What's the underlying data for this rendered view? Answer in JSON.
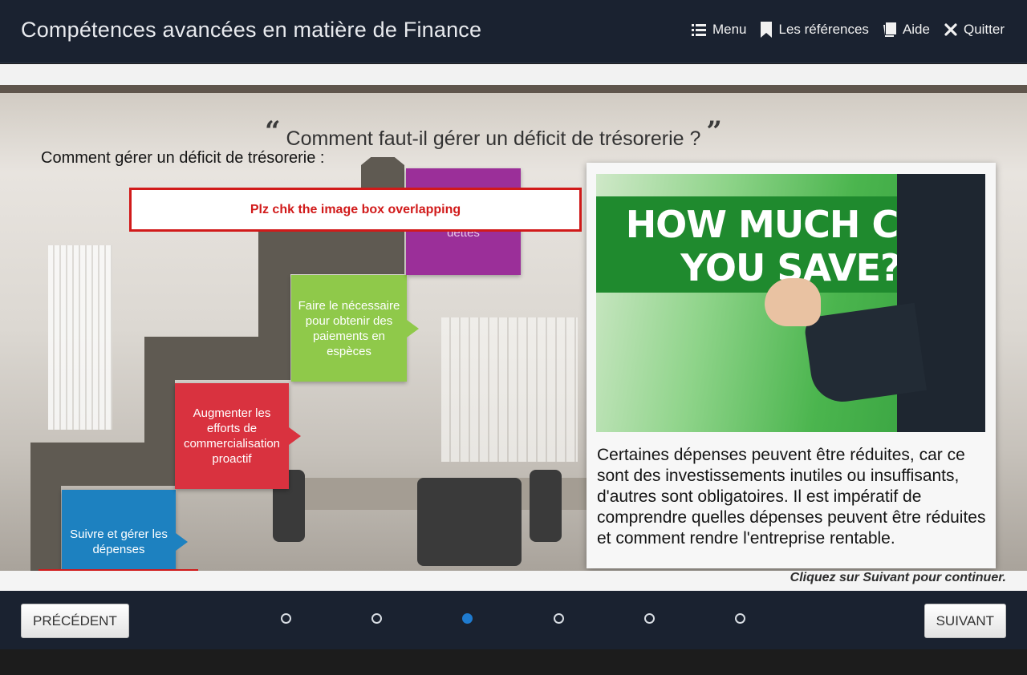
{
  "header": {
    "title": "Compétences avancées en matière de Finance",
    "nav": [
      {
        "label": "Menu",
        "icon": "list-icon"
      },
      {
        "label": "Les références",
        "icon": "bookmark-icon"
      },
      {
        "label": "Aide",
        "icon": "book-icon"
      },
      {
        "label": "Quitter",
        "icon": "close-icon"
      }
    ]
  },
  "slide": {
    "quote_open": "“",
    "quote_title": "Comment faut-il gérer un déficit de trésorerie ?",
    "quote_close": "”",
    "subtitle": "Comment gérer un déficit de trésorerie :",
    "steps": [
      {
        "label": "Suivre et gérer les dépenses",
        "color": "#1d81c0"
      },
      {
        "label": "Augmenter les efforts de commercialisation proactif",
        "color": "#d9323f"
      },
      {
        "label": "Faire le nécessaire pour obtenir des paiements en espèces",
        "color": "#8fc94a"
      },
      {
        "label": "dettes",
        "color": "#9b2f99"
      }
    ],
    "annotation": "Plz chk the image box overlapping",
    "image_text": "HOW MUCH CAN YOU SAVE?",
    "card_text": "Certaines dépenses peuvent être réduites, car ce sont des investissements inutiles ou insuffisants, d'autres sont obligatoires. Il est impératif de comprendre quelles dépenses peuvent être réduites et comment rendre l'entreprise rentable.",
    "continue_hint": "Cliquez sur Suivant pour continuer."
  },
  "footer": {
    "prev_label": "PRÉCÉDENT",
    "next_label": "SUIVANT",
    "page_count": 6,
    "active_page": 3
  },
  "colors": {
    "header_bg": "#1a2230",
    "annotation": "#d11a1a",
    "active_dot": "#1f7bcf"
  }
}
